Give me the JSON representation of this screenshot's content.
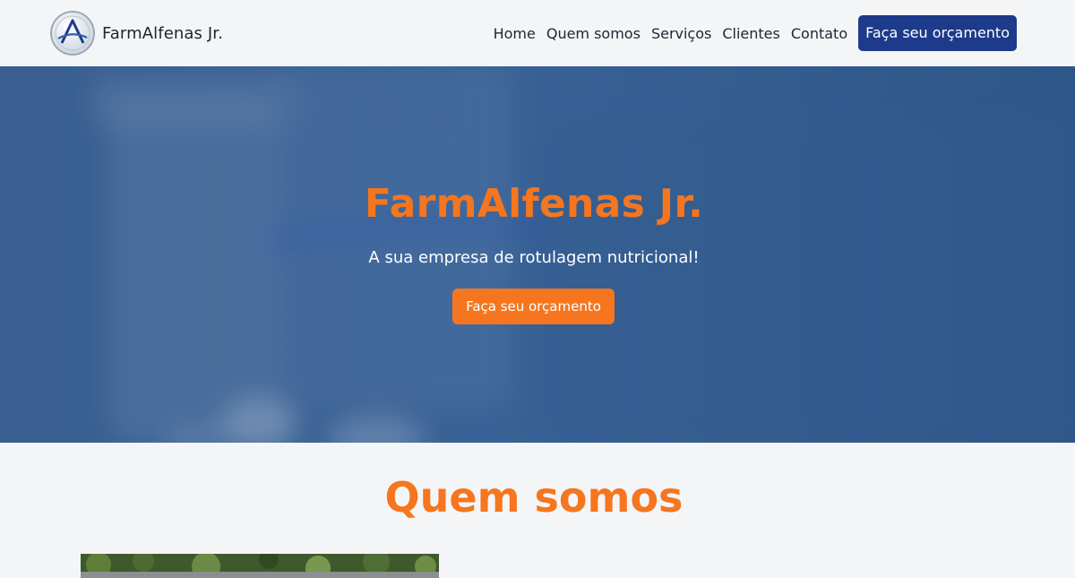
{
  "header": {
    "brand_name": "FarmAlfenas Jr.",
    "nav": [
      {
        "label": "Home"
      },
      {
        "label": "Quem somos"
      },
      {
        "label": "Serviços"
      },
      {
        "label": "Clientes"
      },
      {
        "label": "Contato"
      }
    ],
    "cta_label": "Faça seu orçamento"
  },
  "hero": {
    "title": "FarmAlfenas Jr.",
    "subtitle": "A sua empresa de rotulagem nutricional!",
    "cta_label": "Faça seu orçamento"
  },
  "about": {
    "title": "Quem somos"
  },
  "colors": {
    "accent": "#f5761f",
    "primary": "#1e3a8a",
    "hero_overlay": "#29528a",
    "background": "#f4f5f7"
  },
  "icons": {
    "logo": "farmalfenas-logo-icon"
  }
}
